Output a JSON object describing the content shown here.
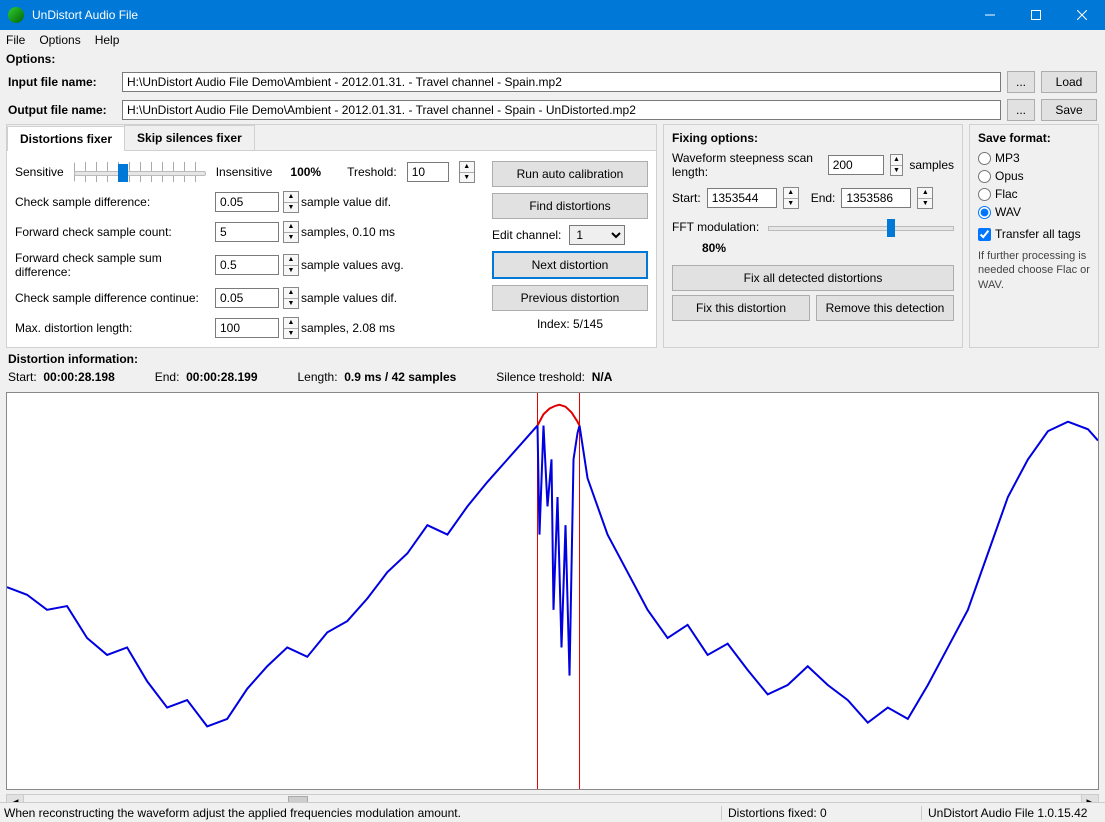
{
  "window": {
    "title": "UnDistort Audio File"
  },
  "menu": {
    "file": "File",
    "options": "Options",
    "help": "Help"
  },
  "options_label": "Options:",
  "input_file": {
    "label": "Input file name:",
    "value": "H:\\UnDistort Audio File Demo\\Ambient - 2012.01.31. - Travel channel - Spain.mp2",
    "load": "Load"
  },
  "output_file": {
    "label": "Output file name:",
    "value": "H:\\UnDistort Audio File Demo\\Ambient - 2012.01.31. - Travel channel - Spain - UnDistorted.mp2",
    "save": "Save"
  },
  "tabs": {
    "distortions": "Distortions fixer",
    "silences": "Skip silences fixer"
  },
  "slider_row": {
    "sensitive": "Sensitive",
    "insensitive": "Insensitive",
    "percent": "100%",
    "treshold_label": "Treshold:",
    "treshold_value": "10"
  },
  "params": {
    "check_sample_diff": {
      "label": "Check sample difference:",
      "value": "0.05",
      "unit": "sample value dif."
    },
    "fwd_count": {
      "label": "Forward check sample count:",
      "value": "5",
      "unit": "samples, 0.10 ms"
    },
    "fwd_sum_diff": {
      "label": "Forward check sample sum difference:",
      "value": "0.5",
      "unit": "sample values avg."
    },
    "check_sample_diff_cont": {
      "label": "Check sample difference continue:",
      "value": "0.05",
      "unit": "sample values dif."
    },
    "max_distortion_len": {
      "label": "Max. distortion length:",
      "value": "100",
      "unit": "samples, 2.08 ms"
    }
  },
  "action_buttons": {
    "run_auto": "Run auto calibration",
    "find": "Find distortions",
    "edit_channel_label": "Edit channel:",
    "edit_channel_value": "1",
    "next": "Next distortion",
    "prev": "Previous distortion",
    "index": "Index: 5/145"
  },
  "fixing": {
    "title": "Fixing options:",
    "steepness_label": "Waveform steepness scan length:",
    "steepness_value": "200",
    "steepness_unit": "samples",
    "start_label": "Start:",
    "start_value": "1353544",
    "end_label": "End:",
    "end_value": "1353586",
    "fft_label": "FFT modulation:",
    "fft_percent": "80%",
    "fix_all": "Fix all detected distortions",
    "fix_this": "Fix this distortion",
    "remove_this": "Remove this detection"
  },
  "save_format": {
    "title": "Save format:",
    "mp3": "MP3",
    "opus": "Opus",
    "flac": "Flac",
    "wav": "WAV",
    "transfer": "Transfer all tags",
    "note": "If further processing is needed choose Flac or WAV."
  },
  "distortion_info": {
    "title": "Distortion information:",
    "start_label": "Start:",
    "start_value": "00:00:28.198",
    "end_label": "End:",
    "end_value": "00:00:28.199",
    "length_label": "Length:",
    "length_value": "0.9 ms / 42 samples",
    "silence_label": "Silence treshold:",
    "silence_value": "N/A"
  },
  "statusbar": {
    "hint": "When reconstructing the waveform adjust the applied frequencies modulation amount.",
    "distortions_fixed": "Distortions fixed: 0",
    "version": "UnDistort Audio File 1.0.15.42"
  },
  "chart_data": {
    "type": "line",
    "xrange": [
      0,
      1090
    ],
    "yrange": [
      -1,
      1
    ],
    "marker_x": [
      530,
      572
    ],
    "series": [
      {
        "name": "waveform-blue",
        "color": "#0000e0",
        "points": [
          [
            0,
            0.02
          ],
          [
            20,
            -0.02
          ],
          [
            40,
            -0.1
          ],
          [
            60,
            -0.08
          ],
          [
            80,
            -0.25
          ],
          [
            100,
            -0.34
          ],
          [
            120,
            -0.3
          ],
          [
            140,
            -0.48
          ],
          [
            160,
            -0.62
          ],
          [
            180,
            -0.58
          ],
          [
            200,
            -0.72
          ],
          [
            220,
            -0.68
          ],
          [
            240,
            -0.52
          ],
          [
            260,
            -0.4
          ],
          [
            280,
            -0.3
          ],
          [
            300,
            -0.35
          ],
          [
            320,
            -0.22
          ],
          [
            340,
            -0.16
          ],
          [
            360,
            -0.04
          ],
          [
            380,
            0.1
          ],
          [
            400,
            0.2
          ],
          [
            420,
            0.35
          ],
          [
            440,
            0.3
          ],
          [
            460,
            0.45
          ],
          [
            480,
            0.58
          ],
          [
            500,
            0.7
          ],
          [
            520,
            0.82
          ],
          [
            530,
            0.88
          ],
          [
            532,
            0.3
          ],
          [
            536,
            0.88
          ],
          [
            540,
            0.45
          ],
          [
            544,
            0.7
          ],
          [
            546,
            -0.1
          ],
          [
            550,
            0.5
          ],
          [
            554,
            -0.3
          ],
          [
            558,
            0.35
          ],
          [
            562,
            -0.45
          ],
          [
            566,
            0.7
          ],
          [
            570,
            0.84
          ],
          [
            572,
            0.88
          ],
          [
            580,
            0.6
          ],
          [
            600,
            0.3
          ],
          [
            620,
            0.1
          ],
          [
            640,
            -0.1
          ],
          [
            660,
            -0.25
          ],
          [
            680,
            -0.18
          ],
          [
            700,
            -0.34
          ],
          [
            720,
            -0.28
          ],
          [
            740,
            -0.42
          ],
          [
            760,
            -0.55
          ],
          [
            780,
            -0.5
          ],
          [
            800,
            -0.4
          ],
          [
            820,
            -0.5
          ],
          [
            840,
            -0.58
          ],
          [
            860,
            -0.7
          ],
          [
            880,
            -0.62
          ],
          [
            900,
            -0.68
          ],
          [
            920,
            -0.5
          ],
          [
            940,
            -0.3
          ],
          [
            960,
            -0.1
          ],
          [
            980,
            0.2
          ],
          [
            1000,
            0.5
          ],
          [
            1020,
            0.7
          ],
          [
            1040,
            0.85
          ],
          [
            1060,
            0.9
          ],
          [
            1080,
            0.86
          ],
          [
            1090,
            0.8
          ]
        ]
      },
      {
        "name": "correction-red",
        "color": "#e00000",
        "points": [
          [
            530,
            0.88
          ],
          [
            536,
            0.94
          ],
          [
            542,
            0.97
          ],
          [
            548,
            0.985
          ],
          [
            552,
            0.99
          ],
          [
            558,
            0.98
          ],
          [
            564,
            0.95
          ],
          [
            570,
            0.9
          ],
          [
            572,
            0.88
          ]
        ]
      }
    ]
  }
}
